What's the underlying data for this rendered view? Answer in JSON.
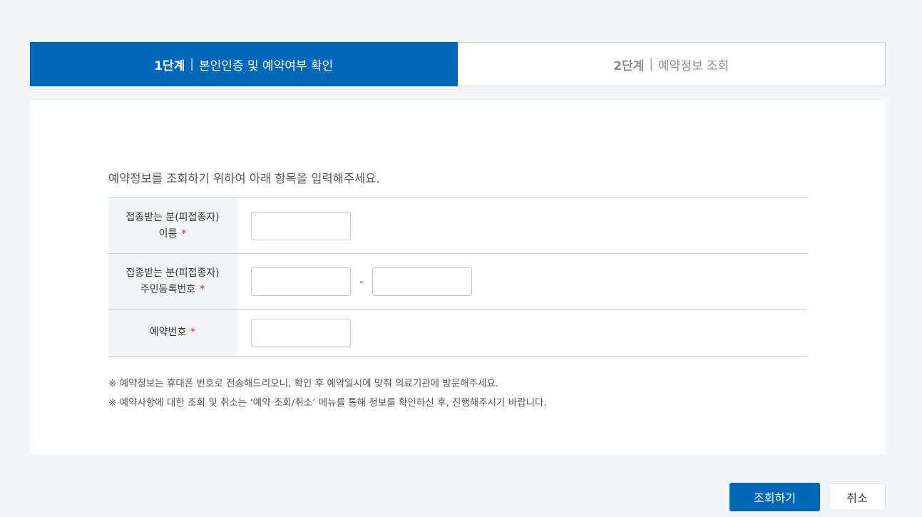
{
  "steps": [
    {
      "num": "1단계",
      "sep": "|",
      "label": "본인인증 및 예약여부 확인"
    },
    {
      "num": "2단계",
      "sep": "|",
      "label": "예약정보 조회"
    }
  ],
  "intro": "예약정보를 조회하기 위하여 아래 항목을 입력해주세요.",
  "form": {
    "name": {
      "label1": "접종받는 분(피접종자)",
      "label2": "이름",
      "required": "*",
      "value": ""
    },
    "rrn": {
      "label1": "접종받는 분(피접종자)",
      "label2": "주민등록번호",
      "required": "*",
      "value_front": "",
      "value_back": "",
      "dash": "-"
    },
    "reservation": {
      "label": "예약번호",
      "required": "*",
      "value": ""
    }
  },
  "notes": [
    "※ 예약정보는 휴대폰 번호로 전송해드리오니, 확인 후 예약일시에 맞춰 의료기관에 방문해주세요.",
    "※ 예약사항에 대한 조회 및 취소는 ‘예약 조회/취소’ 메뉴를 통해 정보를 확인하신 후, 진행해주시기 바랍니다."
  ],
  "buttons": {
    "search": "조회하기",
    "cancel": "취소"
  },
  "colors": {
    "primary": "#0068b7",
    "required": "#d8232a",
    "header_bg": "#f4f5f7"
  }
}
